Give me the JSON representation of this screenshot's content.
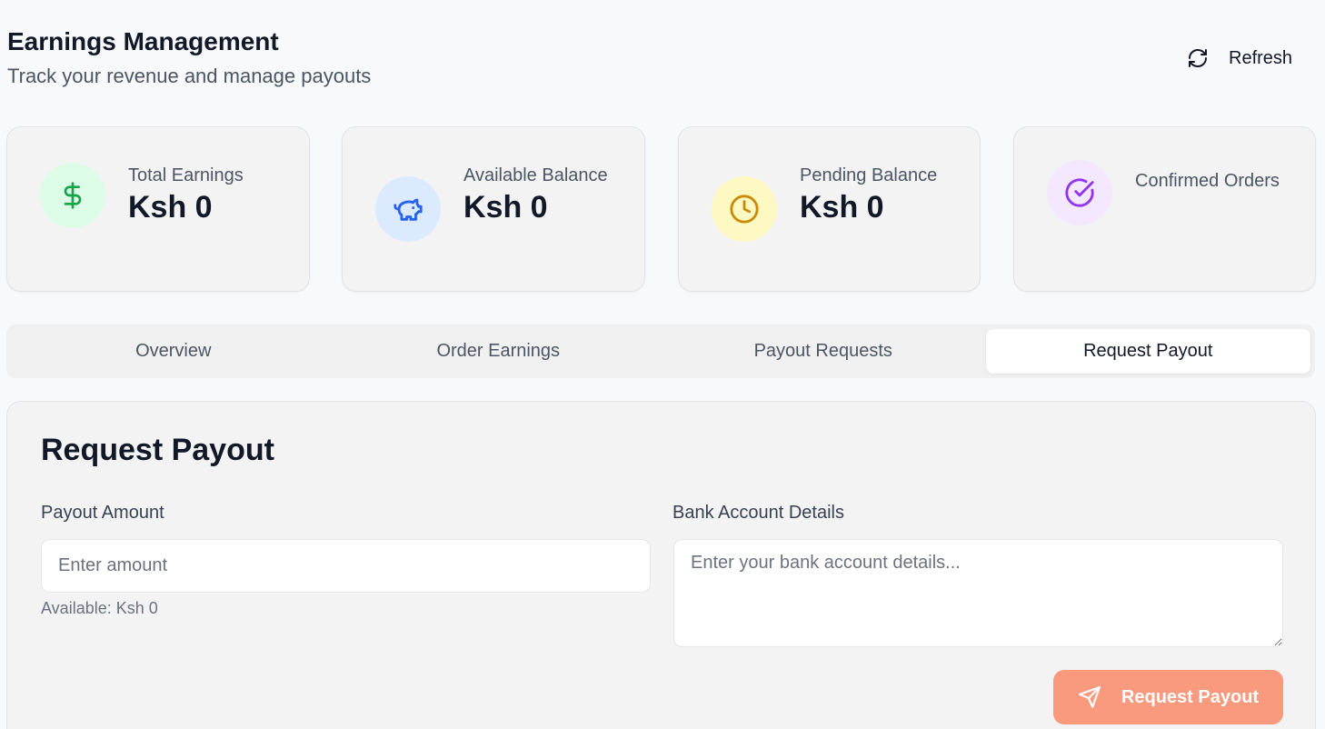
{
  "header": {
    "title": "Earnings Management",
    "subtitle": "Track your revenue and manage payouts",
    "refresh_label": "Refresh",
    "refresh_icon": "refresh-icon"
  },
  "stats": [
    {
      "label": "Total Earnings",
      "value": "Ksh 0",
      "icon": "dollar-icon",
      "color": "#16a34a"
    },
    {
      "label": "Available Balance",
      "value": "Ksh 0",
      "icon": "piggy-bank-icon",
      "color": "#2563eb"
    },
    {
      "label": "Pending Balance",
      "value": "Ksh 0",
      "icon": "clock-icon",
      "color": "#ca8a04"
    },
    {
      "label": "Confirmed Orders",
      "value": "",
      "icon": "check-circle-icon",
      "color": "#9333ea"
    }
  ],
  "tabs": [
    {
      "label": "Overview",
      "active": false
    },
    {
      "label": "Order Earnings",
      "active": false
    },
    {
      "label": "Payout Requests",
      "active": false
    },
    {
      "label": "Request Payout",
      "active": true
    }
  ],
  "form": {
    "title": "Request Payout",
    "amount_label": "Payout Amount",
    "amount_placeholder": "Enter amount",
    "amount_value": "",
    "available_text": "Available: Ksh 0",
    "bank_label": "Bank Account Details",
    "bank_placeholder": "Enter your bank account details...",
    "bank_value": "",
    "submit_label": "Request Payout",
    "submit_icon": "send-icon",
    "submit_color": "#f99a7e"
  }
}
